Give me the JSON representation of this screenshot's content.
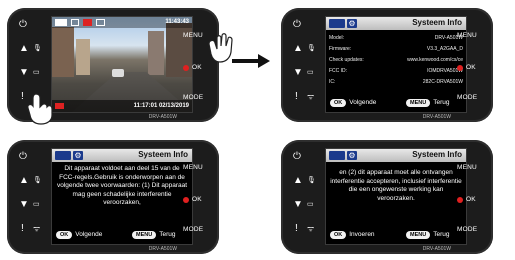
{
  "arrow_color": "#111111",
  "devices": [
    {
      "id": "d1",
      "left_buttons": [
        "⏻",
        "▲",
        "▼",
        "!"
      ],
      "left_icons": [
        "🎙",
        "▭",
        "ᯤ"
      ],
      "right_labels": {
        "menu": "MENU",
        "ok": "OK",
        "mode": "MODE"
      },
      "model": "DRV-A501W",
      "screen": {
        "type": "camera",
        "top_time": "11:43:43",
        "stamp": "11:17:01  02/13/2019"
      }
    },
    {
      "id": "d2",
      "left_buttons": [
        "⏻",
        "▲",
        "▼",
        "!"
      ],
      "left_icons": [
        "🎙",
        "▭",
        "ᯤ"
      ],
      "right_labels": {
        "menu": "MENU",
        "ok": "OK",
        "mode": "MODE"
      },
      "model": "DRV-A501W",
      "screen": {
        "type": "info",
        "title": "Systeem Info",
        "rows": [
          {
            "k": "Model:",
            "v": "DRV-A501W"
          },
          {
            "k": "Firmware:",
            "v": "V3.3_A2GAA_D"
          },
          {
            "k": "Check updates:",
            "v": "www.kenwood.com/cs/ce"
          },
          {
            "k": "FCC ID:",
            "v": "IOMDRVA501W"
          },
          {
            "k": "IC:",
            "v": "282C-DRVA501W"
          }
        ],
        "foot": {
          "ok": "OK",
          "ok_text": "Volgende",
          "menu": "MENU",
          "menu_text": "Terug"
        }
      }
    },
    {
      "id": "d3",
      "left_buttons": [
        "⏻",
        "▲",
        "▼",
        "!"
      ],
      "left_icons": [
        "🎙",
        "▭",
        "ᯤ"
      ],
      "right_labels": {
        "menu": "MENU",
        "ok": "OK",
        "mode": "MODE"
      },
      "model": "DRV-A501W",
      "screen": {
        "type": "info",
        "title": "Systeem Info",
        "message": "Dit apparaat voldoet aan deel 15 van de FCC-regels.Gebruik is onderworpen aan de volgende twee voorwaarden: (1) Dit apparaat mag geen schadelijke interferentie veroorzaken,",
        "foot": {
          "ok": "OK",
          "ok_text": "Volgende",
          "menu": "MENU",
          "menu_text": "Terug"
        }
      }
    },
    {
      "id": "d4",
      "left_buttons": [
        "⏻",
        "▲",
        "▼",
        "!"
      ],
      "left_icons": [
        "🎙",
        "▭",
        "ᯤ"
      ],
      "right_labels": {
        "menu": "MENU",
        "ok": "OK",
        "mode": "MODE"
      },
      "model": "DRV-A501W",
      "screen": {
        "type": "info",
        "title": "Systeem Info",
        "message": "en (2) dit apparaat moet alle ontvangen interferentie accepteren, inclusief interferentie die een ongewenste werking kan veroorzaken.",
        "foot": {
          "ok": "OK",
          "ok_text": "Invoeren",
          "menu": "MENU",
          "menu_text": "Terug"
        }
      }
    }
  ]
}
